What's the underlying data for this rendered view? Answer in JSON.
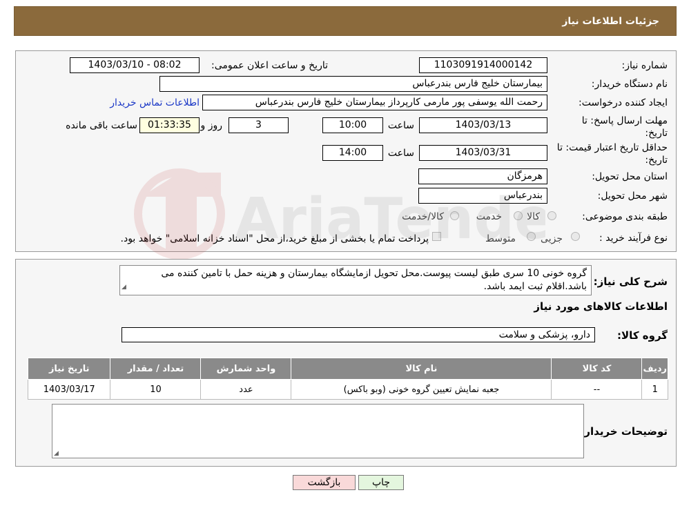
{
  "header": {
    "title": "جزئیات اطلاعات نیاز"
  },
  "form": {
    "need_number_label": "شماره نیاز:",
    "need_number": "1103091914000142",
    "announce_label": "تاریخ و ساعت اعلان عمومی:",
    "announce_value": "1403/03/10 - 08:02",
    "buyer_org_label": "نام دستگاه خریدار:",
    "buyer_org": "بیمارستان خلیج فارس بندرعباس",
    "creator_label": "ایجاد کننده درخواست:",
    "creator": "رحمت الله یوسفی پور مارمی کارپرداز بیمارستان خلیج فارس بندرعباس",
    "contact_link": "اطلاعات تماس خریدار",
    "deadline_label_1": "مهلت ارسال پاسخ: تا",
    "deadline_label_2": "تاریخ:",
    "deadline_date": "1403/03/13",
    "time_label": "ساعت",
    "deadline_time": "10:00",
    "days_value": "3",
    "days_label": "روز و",
    "remaining_time": "01:33:35",
    "remaining_label": "ساعت باقی مانده",
    "validity_label_1": "حداقل تاریخ اعتبار قیمت: تا",
    "validity_label_2": "تاریخ:",
    "validity_date": "1403/03/31",
    "validity_time": "14:00",
    "province_label": "استان محل تحویل:",
    "province": "هرمزگان",
    "city_label": "شهر محل تحویل:",
    "city": "بندرعباس",
    "category_label": "طبقه بندی موضوعی:",
    "category_options": [
      "کالا",
      "خدمت",
      "کالا/خدمت"
    ],
    "purchase_type_label": "نوع فرآیند خرید :",
    "purchase_options": [
      "جزیی",
      "متوسط"
    ],
    "purchase_note": "پرداخت تمام یا بخشی از مبلغ خرید،از محل \"اسناد خزانه اسلامی\" خواهد بود."
  },
  "description": {
    "label": "شرح کلی نیاز:",
    "text": "گروه خونی 10 سری طبق لیست پیوست.محل تحویل ازمایشگاه بیمارستان و هزینه حمل با تامین کننده می باشد.اقلام ثبت ایمد باشد.",
    "goods_info_title": "اطلاعات کالاهای مورد نیاز",
    "goods_group_label": "گروه کالا:",
    "goods_group": "دارو، پزشکی و سلامت"
  },
  "table": {
    "headers": [
      "ردیف",
      "کد کالا",
      "نام کالا",
      "واحد شمارش",
      "تعداد / مقدار",
      "تاریخ نیاز"
    ],
    "rows": [
      [
        "1",
        "--",
        "جعبه نمایش تعیین گروه خونی (وبو باکس)",
        "عدد",
        "10",
        "1403/03/17"
      ]
    ]
  },
  "buyer_notes_label": "توضیحات خریدار:",
  "buttons": {
    "print": "چاپ",
    "back": "بازگشت"
  },
  "watermark": {
    "text": "AriaTender.neT"
  },
  "colors": {
    "header_bg": "#8b6a3c",
    "link": "#1a37c6",
    "table_header_bg": "#8a8a8a",
    "back_button_bg": "#f9d9d9",
    "print_button_bg": "#e4f6de"
  }
}
